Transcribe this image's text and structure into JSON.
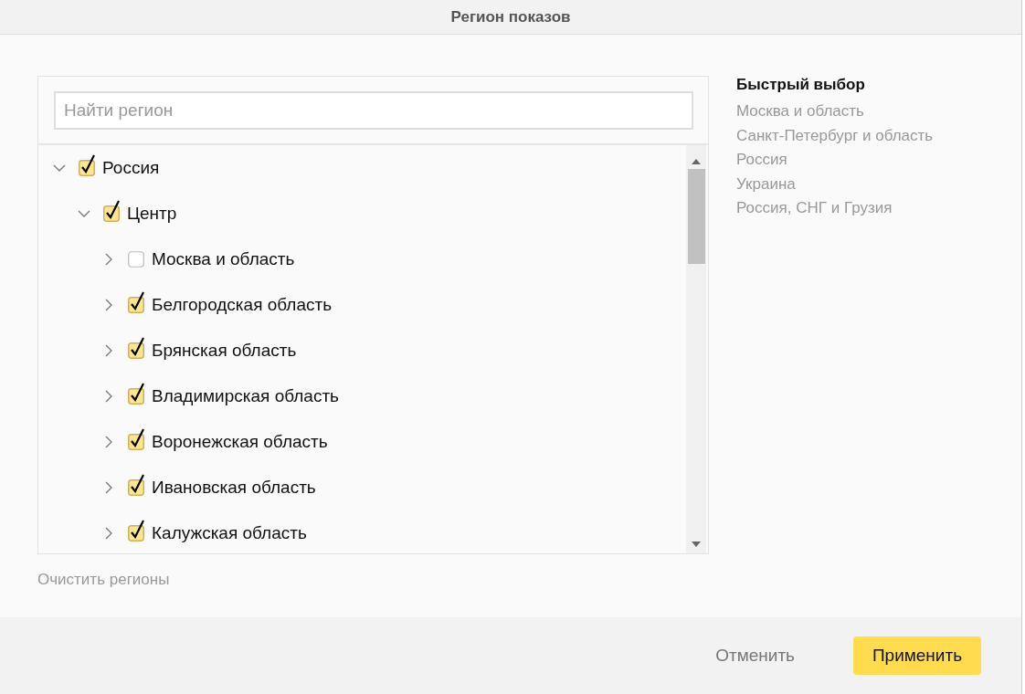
{
  "window": {
    "title": "Регион показов"
  },
  "search": {
    "placeholder": "Найти регион"
  },
  "tree": [
    {
      "label": "Россия",
      "expanded": true,
      "checked": true,
      "children": [
        {
          "label": "Центр",
          "expanded": true,
          "checked": true,
          "children": [
            {
              "label": "Москва и область",
              "expanded": false,
              "checked": false
            },
            {
              "label": "Белгородская область",
              "expanded": false,
              "checked": true
            },
            {
              "label": "Брянская область",
              "expanded": false,
              "checked": true
            },
            {
              "label": "Владимирская область",
              "expanded": false,
              "checked": true
            },
            {
              "label": "Воронежская область",
              "expanded": false,
              "checked": true
            },
            {
              "label": "Ивановская область",
              "expanded": false,
              "checked": true
            },
            {
              "label": "Калужская область",
              "expanded": false,
              "checked": true
            }
          ]
        }
      ]
    }
  ],
  "quick_select": {
    "title": "Быстрый выбор",
    "items": [
      "Москва и область",
      "Санкт-Петербург и область",
      "Россия",
      "Украина",
      "Россия, СНГ и Грузия"
    ]
  },
  "clear_link": "Очистить регионы",
  "buttons": [
    {
      "label": "Отменить",
      "kind": "secondary"
    },
    {
      "label": "Применить",
      "kind": "primary"
    }
  ]
}
